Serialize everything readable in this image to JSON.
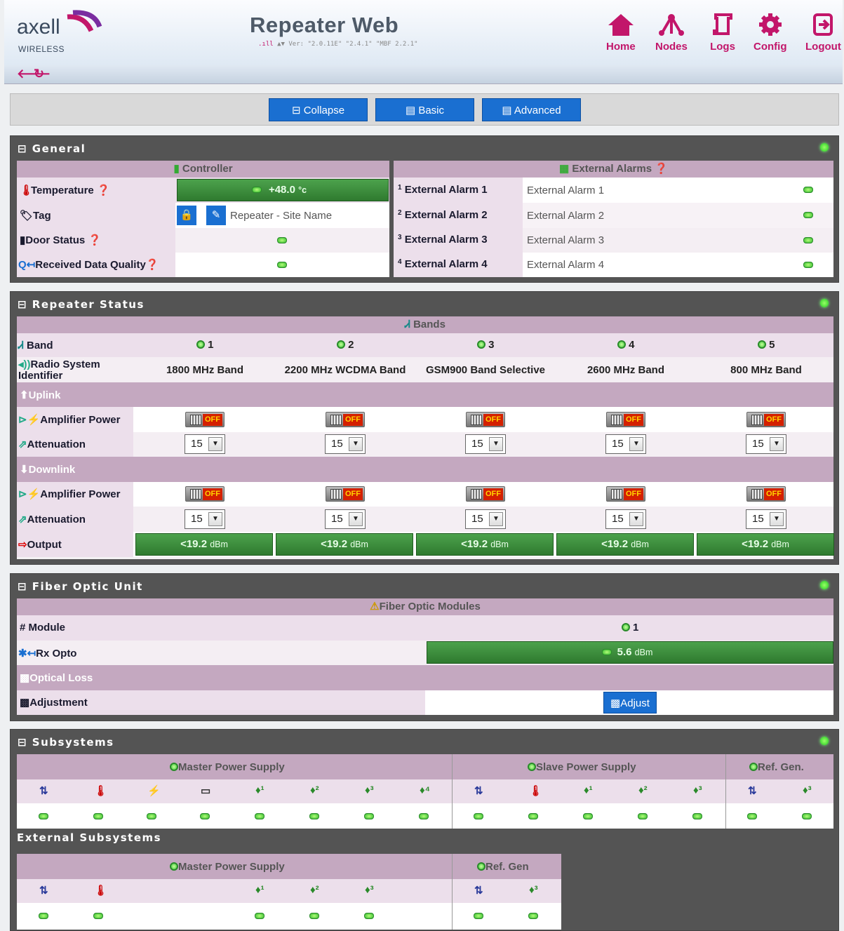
{
  "header": {
    "logo_text": "axell",
    "logo_sub": "WIRELESS",
    "title": "Repeater Web",
    "version": "Ver: \"2.0.11E\" \"2.4.1\" \"MBF 2.2.1\""
  },
  "nav": {
    "home": "Home",
    "nodes": "Nodes",
    "logs": "Logs",
    "config": "Config",
    "logout": "Logout"
  },
  "modes": {
    "collapse": "Collapse",
    "basic": "Basic",
    "advanced": "Advanced"
  },
  "general": {
    "title": "General",
    "controller_header": "Controller",
    "alarms_header": "External Alarms",
    "temperature_label": "Temperature",
    "temperature_value": "+48.0",
    "temperature_unit": "°c",
    "tag_label": "Tag",
    "tag_value": "Repeater - Site Name",
    "door_label": "Door Status",
    "rdq_label": "Received Data Quality",
    "alarms": [
      {
        "label": "External Alarm 1",
        "value": "External Alarm 1",
        "idx": "1"
      },
      {
        "label": "External Alarm 2",
        "value": "External Alarm 2",
        "idx": "2"
      },
      {
        "label": "External Alarm 3",
        "value": "External Alarm 3",
        "idx": "3"
      },
      {
        "label": "External Alarm 4",
        "value": "External Alarm 4",
        "idx": "4"
      }
    ]
  },
  "repeater": {
    "title": "Repeater Status",
    "bands_header": "Bands",
    "band_label": "Band",
    "rsi_label": "Radio System Identifier",
    "uplink": "Uplink",
    "downlink": "Downlink",
    "amp_label": "Amplifier Power",
    "att_label": "Attenuation",
    "output_label": "Output",
    "toggle_text": "OFF",
    "bands": [
      {
        "num": "1",
        "name": "1800 MHz Band",
        "ul_att": "15",
        "dl_att": "15",
        "out": "<19.2",
        "unit": "dBm"
      },
      {
        "num": "2",
        "name": "2200 MHz WCDMA Band",
        "ul_att": "15",
        "dl_att": "15",
        "out": "<19.2",
        "unit": "dBm"
      },
      {
        "num": "3",
        "name": "GSM900 Band Selective",
        "ul_att": "15",
        "dl_att": "15",
        "out": "<19.2",
        "unit": "dBm"
      },
      {
        "num": "4",
        "name": "2600 MHz Band",
        "ul_att": "15",
        "dl_att": "15",
        "out": "<19.2",
        "unit": "dBm"
      },
      {
        "num": "5",
        "name": "800 MHz Band",
        "ul_att": "15",
        "dl_att": "15",
        "out": "<19.2",
        "unit": "dBm"
      }
    ]
  },
  "fiber": {
    "title": "Fiber Optic Unit",
    "modules_header": "Fiber Optic Modules",
    "module_label": "Module",
    "module_num": "1",
    "rx_label": "Rx Opto",
    "rx_value": "5.6",
    "rx_unit": "dBm",
    "optical_loss": "Optical Loss",
    "adjustment": "Adjustment",
    "adjust_button": "Adjust"
  },
  "subsystems": {
    "title": "Subsystems",
    "master": "Master Power Supply",
    "slave": "Slave Power Supply",
    "refgen": "Ref. Gen.",
    "external_title": "External Subsystems",
    "ext_master": "Master Power Supply",
    "ext_refgen": "Ref. Gen",
    "master_icons": [
      "module-icon",
      "thermometer-icon",
      "power-plug-icon",
      "battery-icon",
      "plug-1-icon",
      "plug-2-icon",
      "plug-3-icon",
      "plug-4-icon"
    ],
    "slave_icons": [
      "module-icon",
      "thermometer-icon",
      "plug-1-icon",
      "plug-2-icon",
      "plug-3-icon"
    ],
    "refgen_icons": [
      "module-icon",
      "plug-3-icon"
    ]
  }
}
